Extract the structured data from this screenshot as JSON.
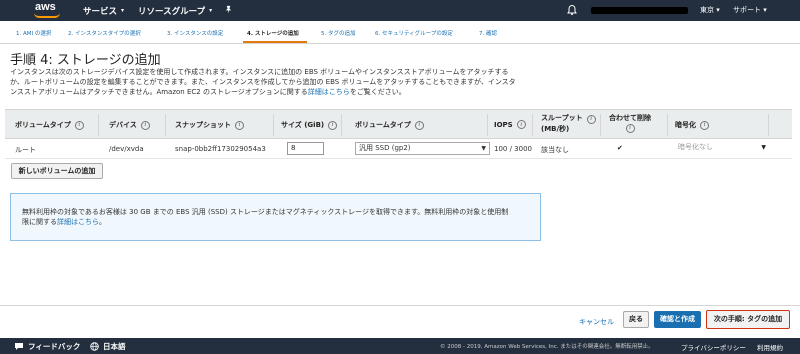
{
  "topnav": {
    "logo": "aws",
    "services": "サービス",
    "resource_groups": "リソースグループ",
    "region": "東京",
    "support": "サポート"
  },
  "steps": [
    {
      "label": "1. AMI の選択"
    },
    {
      "label": "2. インスタンスタイプの選択"
    },
    {
      "label": "3. インスタンスの設定"
    },
    {
      "label": "4. ストレージの追加",
      "active": true
    },
    {
      "label": "5. タグの追加"
    },
    {
      "label": "6. セキュリティグループの設定"
    },
    {
      "label": "7. 確認"
    }
  ],
  "page": {
    "title": "手順 4: ストレージの追加",
    "desc_1": "インスタンスは次のストレージデバイス設定を使用して作成されます。インスタンスに追加の EBS ボリュームやインスタンスストアボリュームをアタッチする",
    "desc_2": "か、ルートボリュームの設定を編集することができます。また、インスタンスを作成してから追加の EBS ボリュームをアタッチすることもできますが、インスタ",
    "desc_3": "ンスストアボリュームはアタッチできません。Amazon EC2 のストレージオプションに関する",
    "desc_link": "詳細はこちら",
    "desc_tail": "をご覧ください。"
  },
  "table": {
    "headers": {
      "volume_type": "ボリュームタイプ",
      "device": "デバイス",
      "snapshot": "スナップショット",
      "size": "サイズ (GiB)",
      "vol_type": "ボリュームタイプ",
      "iops": "IOPS",
      "throughput_1": "スループット",
      "throughput_2": "(MB/秒)",
      "delete_1": "合わせて削除",
      "encryption": "暗号化"
    },
    "row": {
      "volume_type": "ルート",
      "device": "/dev/xvda",
      "snapshot": "snap-0bb2ff173029054a3",
      "size": "8",
      "vol_type": "汎用 SSD (gp2)",
      "iops": "100 / 3000",
      "throughput": "該当なし",
      "delete_on_termination": true,
      "encryption": "暗号化なし"
    }
  },
  "add_volume_button": "新しいボリュームの追加",
  "notice": {
    "text_1": "無料利用枠の対象であるお客様は 30 GB までの EBS 汎用 (SSD) ストレージまたはマグネティックストレージを取得できます。無料利用枠の対象と使用制",
    "text_2": "限に関する",
    "link": "詳細はこちら",
    "tail": "。"
  },
  "actions": {
    "cancel": "キャンセル",
    "back": "戻る",
    "review": "確認と作成",
    "next": "次の手順: タグの追加"
  },
  "footer": {
    "feedback": "フィードバック",
    "language": "日本語",
    "copyright": "© 2008 - 2019, Amazon Web Services, Inc. またはその関連会社。無断転用禁止。",
    "privacy": "プライバシーポリシー",
    "terms": "利用規約"
  },
  "colors": {
    "nav_bg": "#232f3e",
    "aws_orange": "#ff9900",
    "link_blue": "#1a6fb0",
    "next_border": "#d13212"
  }
}
